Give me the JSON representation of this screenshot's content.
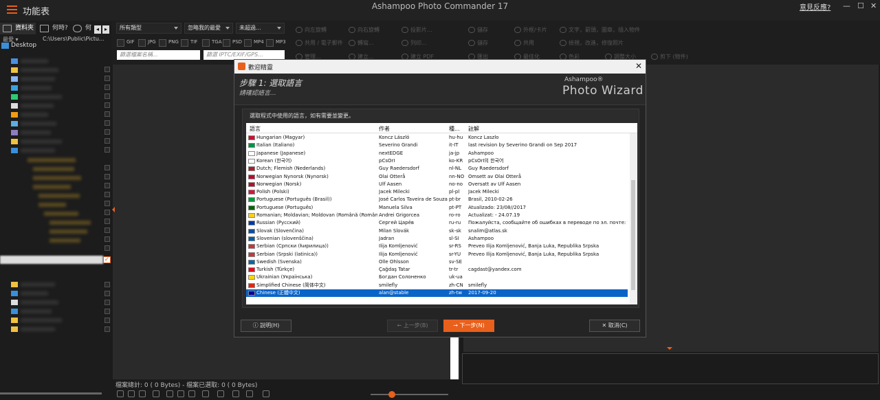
{
  "app": {
    "menu_label": "功能表",
    "title": "Ashampoo Photo Commander 17",
    "feedback": "意見反應?",
    "win_min": "—",
    "win_max": "☐",
    "win_close": "✕"
  },
  "left_pane": {
    "tabs": [
      "資料夾",
      "何時?",
      "何"
    ],
    "path_label": "最愛 ▾",
    "path": "C:\\Users\\Public\\Pictu...",
    "tree_root": "Desktop"
  },
  "toolbar": {
    "filter_type": "所有類型",
    "filter_ignore": "忽略我的最愛",
    "filter_rated": "未超過...",
    "formats": [
      "GIF",
      "JPG",
      "PNG",
      "TIF",
      "TGA",
      "PSD",
      "MP4",
      "MP3"
    ],
    "search_name_placeholder": "篩選檔案名稱...",
    "search_meta_placeholder": "篩選 IPTC/EXIF/GPS...",
    "actions": [
      "向左旋轉",
      "向右旋轉",
      "投影片...",
      "儲存",
      "外框/卡片",
      "文字，箭頭，圖章，插入物件",
      "共用 / 電子郵件",
      "轉寫...",
      "列印...",
      "儲存",
      "共用",
      "檢視，改進，修復照片",
      "管理...",
      "建立...",
      "建立 PDF",
      "匯出",
      "最佳化",
      "色彩",
      "調整大小",
      "剪下 (物件)"
    ]
  },
  "status": {
    "counts": "檔案總計: 0 (    0 Bytes) - 檔案已選取: 0 (    0 Bytes)"
  },
  "dialog": {
    "title": "歡迎精靈",
    "step_title": "步驟 1: 選取語言",
    "step_sub": "請確認語言...",
    "brand_small": "Ashampoo®",
    "brand_big": "Photo Wizard",
    "instruction": "選取程式中使用的語言，如有需要並變更。",
    "columns": [
      "語言",
      "作者",
      "種...",
      "註解"
    ],
    "rows": [
      {
        "lang": "Hungarian (Magyar)",
        "author": "Koncz László",
        "code": "hu-hu",
        "note": "Koncz Laszlo",
        "flag": "#c8102e"
      },
      {
        "lang": "Italian (Italiano)",
        "author": "Severino Grandi",
        "code": "it-IT",
        "note": "last revision by Severino Grandi on Sep 2017",
        "flag": "#009246"
      },
      {
        "lang": "Japanese (Japanese)",
        "author": "nextEDGE",
        "code": "ja-jp",
        "note": "Ashampoo",
        "flag": "#ffffff"
      },
      {
        "lang": "Korean (한국어)",
        "author": "pCsOrI",
        "code": "ko-KR",
        "note": "pCsOrI의 한국어",
        "flag": "#ffffff"
      },
      {
        "lang": "Dutch; Flemish (Nederlands)",
        "author": "Guy Raedersdorf",
        "code": "nl-NL",
        "note": "Guy Raedersdorf",
        "flag": "#ae1c28"
      },
      {
        "lang": "Norwegian Nynorsk (Nynorsk)",
        "author": "Olai Otterå",
        "code": "nn-NO",
        "note": "Omsett av Olai Otterå",
        "flag": "#ba0c2f"
      },
      {
        "lang": "Norwegian (Norsk)",
        "author": "Ulf Aasen",
        "code": "no-no",
        "note": "Oversatt av Ulf Aasen",
        "flag": "#ba0c2f"
      },
      {
        "lang": "Polish (Polski)",
        "author": "Jacek Milecki",
        "code": "pl-pl",
        "note": "Jacek Milecki",
        "flag": "#dc143c"
      },
      {
        "lang": "Portuguese (Português (Brasil))",
        "author": "José Carlos Taveira de Souza",
        "code": "pt-br",
        "note": "Brasil, 2010-02-26",
        "flag": "#009c3b"
      },
      {
        "lang": "Portuguese (Português)",
        "author": "Manuela Silva",
        "code": "pt-PT",
        "note": "Atualizado: 23/08//2017",
        "flag": "#006600"
      },
      {
        "lang": "Romanian; Moldavian; Moldovan (Română (România))",
        "author": "Andrei Grigorcea",
        "code": "ro-ro",
        "note": "Actualizat: - 24.07.19",
        "flag": "#fcd116"
      },
      {
        "lang": "Russian (Русский)",
        "author": "Сергей Царёв",
        "code": "ru-ru",
        "note": "Пожалуйста, сообщайте об ошибках в переводе по эл. почте: tsare",
        "flag": "#0039a6"
      },
      {
        "lang": "Slovak (Slovenčina)",
        "author": "Milan Slovák",
        "code": "sk-sk",
        "note": "snalim@atlas.sk",
        "flag": "#0b4ea2"
      },
      {
        "lang": "Slovenian (slovenščina)",
        "author": "Jadran",
        "code": "sl-SI",
        "note": "Ashampoo",
        "flag": "#005da4"
      },
      {
        "lang": "Serbian (Српски (ћирилица))",
        "author": "Ilija Komljenović",
        "code": "sr-RS",
        "note": "Preveo Ilija Komljenović, Banja Luka, Republika Srpska",
        "flag": "#c6363c"
      },
      {
        "lang": "Serbian (Srpski (latinica))",
        "author": "Ilija Komljenović",
        "code": "sr-YU",
        "note": "Preveo Ilija Komljenović, Banja Luka, Republika Srpska",
        "flag": "#c6363c"
      },
      {
        "lang": "Swedish (Svenska)",
        "author": "Olle Ohlsson",
        "code": "sv-SE",
        "note": "",
        "flag": "#006aa7"
      },
      {
        "lang": "Turkish (Türkçe)",
        "author": "Çağdaş Tatar",
        "code": "tr-tr",
        "note": "cagdast@yandex.com",
        "flag": "#e30a17"
      },
      {
        "lang": "Ukrainian (Українська)",
        "author": "Богдан Солоненко",
        "code": "uk-ua",
        "note": "",
        "flag": "#ffd700"
      },
      {
        "lang": "Simplified Chinese (简体中文)",
        "author": "smilefly",
        "code": "zh-CN",
        "note": "smilefly",
        "flag": "#de2910"
      },
      {
        "lang": "Chinese (正體中文)",
        "author": "alan@stable",
        "code": "zh-tw",
        "note": "2017-09-20",
        "flag": "#000095",
        "selected": true
      }
    ],
    "btn_help": "說明(H)",
    "btn_prev": "← 上一步(B)",
    "btn_next": "→ 下一步(N)",
    "btn_cancel": "取消(C)"
  }
}
